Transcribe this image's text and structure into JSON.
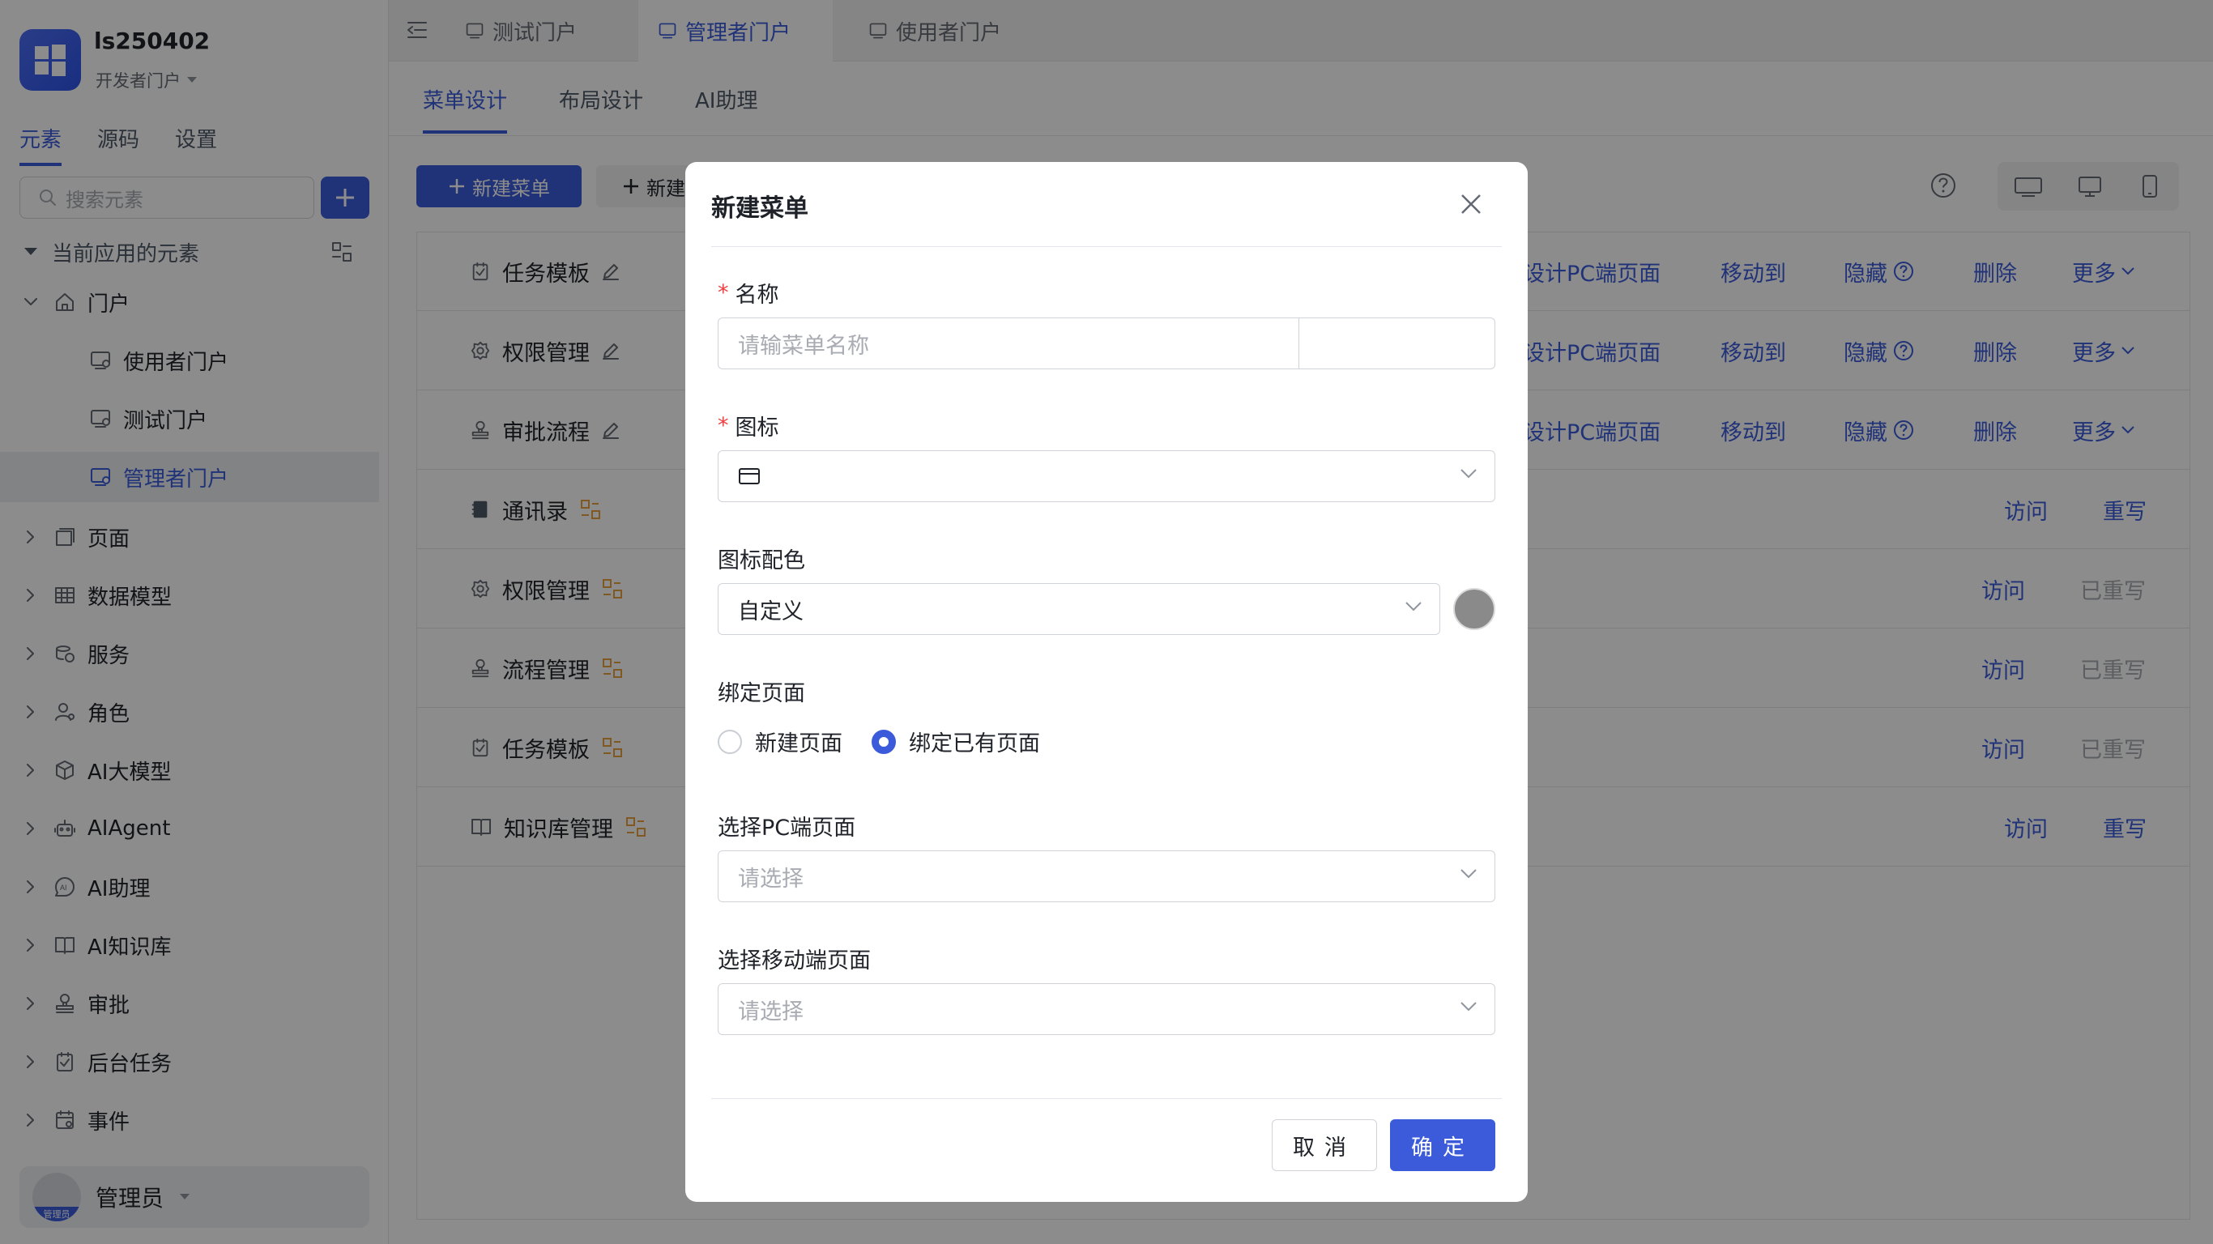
{
  "app": {
    "name": "ls250402",
    "subtitle": "开发者门户"
  },
  "sidebar": {
    "tabs": [
      "元素",
      "源码",
      "设置"
    ],
    "search_placeholder": "搜索元素",
    "section_title": "当前应用的元素",
    "tree": [
      {
        "label": "门户",
        "icon": "home-icon",
        "expanded": true
      },
      {
        "label": "使用者门户",
        "icon": "portal-icon",
        "child": true
      },
      {
        "label": "测试门户",
        "icon": "portal-icon",
        "child": true
      },
      {
        "label": "管理者门户",
        "icon": "portal-icon",
        "child": true,
        "selected": true
      },
      {
        "label": "页面",
        "icon": "pages-icon"
      },
      {
        "label": "数据模型",
        "icon": "table-icon"
      },
      {
        "label": "服务",
        "icon": "service-icon"
      },
      {
        "label": "角色",
        "icon": "role-icon"
      },
      {
        "label": "AI大模型",
        "icon": "cube-icon"
      },
      {
        "label": "AIAgent",
        "icon": "robot-icon"
      },
      {
        "label": "AI助理",
        "icon": "ai-icon"
      },
      {
        "label": "AI知识库",
        "icon": "book-icon"
      },
      {
        "label": "审批",
        "icon": "stamp-icon"
      },
      {
        "label": "后台任务",
        "icon": "task-icon"
      },
      {
        "label": "事件",
        "icon": "event-icon"
      }
    ],
    "user": {
      "name": "管理员",
      "avatar_label": "管理员"
    }
  },
  "topbar": {
    "tabs": [
      "测试门户",
      "管理者门户",
      "使用者门户"
    ],
    "active": 1
  },
  "subtabs": {
    "items": [
      "菜单设计",
      "布局设计",
      "AI助理"
    ],
    "active": 0
  },
  "toolbar": {
    "new_menu": "新建菜单",
    "new_other": "新建"
  },
  "table": {
    "rows": [
      {
        "name": "任务模板",
        "icon": "task-icon",
        "mark": "edit-icon",
        "actions": [
          "设计PC端页面",
          "移动到",
          "隐藏",
          "删除",
          "更多"
        ]
      },
      {
        "name": "权限管理",
        "icon": "gear-icon",
        "mark": "edit-icon",
        "actions": [
          "设计PC端页面",
          "移动到",
          "隐藏",
          "删除",
          "更多"
        ]
      },
      {
        "name": "审批流程",
        "icon": "stamp-icon",
        "mark": "edit-icon",
        "actions": [
          "设计PC端页面",
          "移动到",
          "隐藏",
          "删除",
          "更多"
        ]
      },
      {
        "name": "通讯录",
        "icon": "contacts-icon",
        "mark": "link-icon",
        "actions": [
          "访问",
          "重写"
        ]
      },
      {
        "name": "权限管理",
        "icon": "gear-icon",
        "mark": "link-icon",
        "actions": [
          "访问",
          "已重写"
        ]
      },
      {
        "name": "流程管理",
        "icon": "stamp-icon",
        "mark": "link-icon",
        "actions": [
          "访问",
          "已重写"
        ]
      },
      {
        "name": "任务模板",
        "icon": "task-icon",
        "mark": "link-icon",
        "actions": [
          "访问",
          "已重写"
        ]
      },
      {
        "name": "知识库管理",
        "icon": "book-icon",
        "mark": "link-icon",
        "actions": [
          "访问",
          "重写"
        ]
      }
    ]
  },
  "modal": {
    "title": "新建菜单",
    "name_label": "名称",
    "name_placeholder": "请输菜单名称",
    "icon_label": "图标",
    "color_label": "图标配色",
    "color_value": "自定义",
    "color_swatch": "#8a8a8a",
    "bind_label": "绑定页面",
    "radio_new": "新建页面",
    "radio_existing": "绑定已有页面",
    "radio_selected": "绑定已有页面",
    "pc_label": "选择PC端页面",
    "pc_placeholder": "请选择",
    "mobile_label": "选择移动端页面",
    "mobile_placeholder": "请选择",
    "cancel": "取消",
    "ok": "确定"
  },
  "colors": {
    "primary": "#3b5bdb",
    "required": "#f53f3f",
    "link_mark": "#e8a33d"
  }
}
